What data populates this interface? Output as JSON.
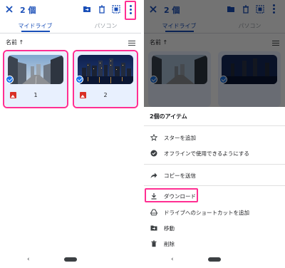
{
  "toolbar": {
    "selected_count": "2 個"
  },
  "tabs": [
    {
      "label": "マイドライブ",
      "active": true
    },
    {
      "label": "パソコン",
      "active": false
    }
  ],
  "sort": {
    "label": "名前 ↑"
  },
  "files": [
    {
      "name": "1",
      "type": "image"
    },
    {
      "name": "2",
      "type": "image"
    }
  ],
  "sheet": {
    "title": "2個のアイテム",
    "items": [
      {
        "label": "スターを追加",
        "icon": "star-icon"
      },
      {
        "label": "オフラインで使用できるようにする",
        "icon": "offline-check-icon"
      },
      {
        "label": "コピーを送信",
        "icon": "share-arrow-icon"
      },
      {
        "label": "ダウンロード",
        "icon": "download-icon"
      },
      {
        "label": "ドライブへのショートカットを追加",
        "icon": "drive-shortcut-icon"
      },
      {
        "label": "移動",
        "icon": "move-folder-icon"
      },
      {
        "label": "削除",
        "icon": "trash-icon"
      }
    ]
  },
  "colors": {
    "accent": "#1a4fb8",
    "highlight": "#ff2f92",
    "selection_bg": "#e8f0fe"
  }
}
